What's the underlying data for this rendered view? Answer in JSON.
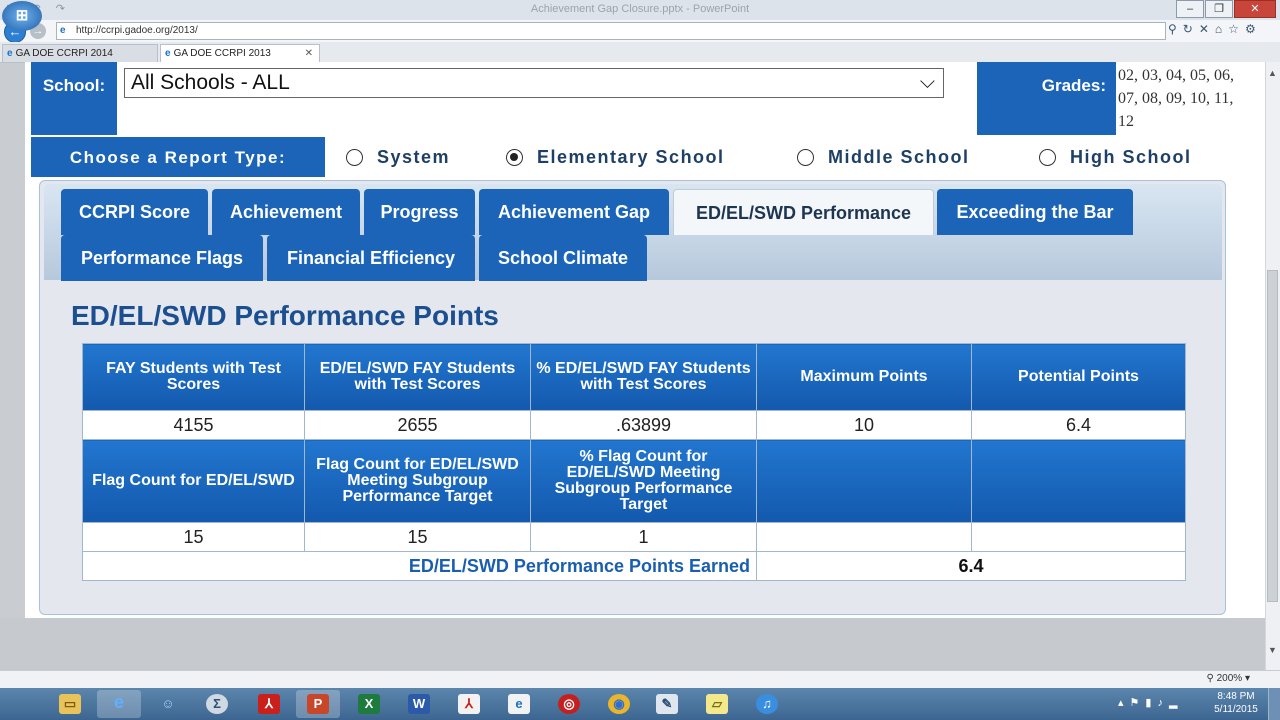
{
  "browser": {
    "window_title": "Achievement Gap Closure.pptx - PowerPoint",
    "address": "http://ccrpi.gadoe.org/2013/",
    "tabs": [
      {
        "label": "GA DOE CCRPI 2014"
      },
      {
        "label": "GA DOE CCRPI 2013"
      }
    ],
    "zoom": "200%"
  },
  "filters": {
    "school_label": "School:",
    "school_value": "All Schools - ALL",
    "grades_label": "Grades:",
    "grades_value": "02, 03, 04, 05, 06, 07, 08, 09, 10, 11, 12"
  },
  "report_type": {
    "label": "Choose a Report Type:",
    "options": [
      {
        "label": "System",
        "selected": false
      },
      {
        "label": "Elementary School",
        "selected": true
      },
      {
        "label": "Middle School",
        "selected": false
      },
      {
        "label": "High School",
        "selected": false
      }
    ]
  },
  "tabs": [
    {
      "label": "CCRPI Score"
    },
    {
      "label": "Achievement"
    },
    {
      "label": "Progress"
    },
    {
      "label": "Achievement Gap"
    },
    {
      "label": "ED/EL/SWD Performance",
      "active": true
    },
    {
      "label": "Exceeding the Bar"
    },
    {
      "label": "Performance Flags"
    },
    {
      "label": "Financial Efficiency"
    },
    {
      "label": "School Climate"
    }
  ],
  "section": {
    "title": "ED/EL/SWD Performance Points"
  },
  "table": {
    "headers_1": [
      "FAY Students with Test Scores",
      "ED/EL/SWD FAY Students with Test Scores",
      "% ED/EL/SWD FAY Students with Test Scores",
      "Maximum Points",
      "Potential Points"
    ],
    "values_1": [
      "4155",
      "2655",
      ".63899",
      "10",
      "6.4"
    ],
    "headers_2": [
      "Flag Count for ED/EL/SWD",
      "Flag Count for ED/EL/SWD Meeting Subgroup Performance Target",
      "% Flag Count for ED/EL/SWD Meeting Subgroup Performance Target",
      "",
      ""
    ],
    "values_2": [
      "15",
      "15",
      "1",
      "",
      ""
    ],
    "earned_label": "ED/EL/SWD Performance Points Earned",
    "earned_value": "6.4"
  },
  "taskbar": {
    "time": "8:48 PM",
    "date": "5/11/2015"
  }
}
